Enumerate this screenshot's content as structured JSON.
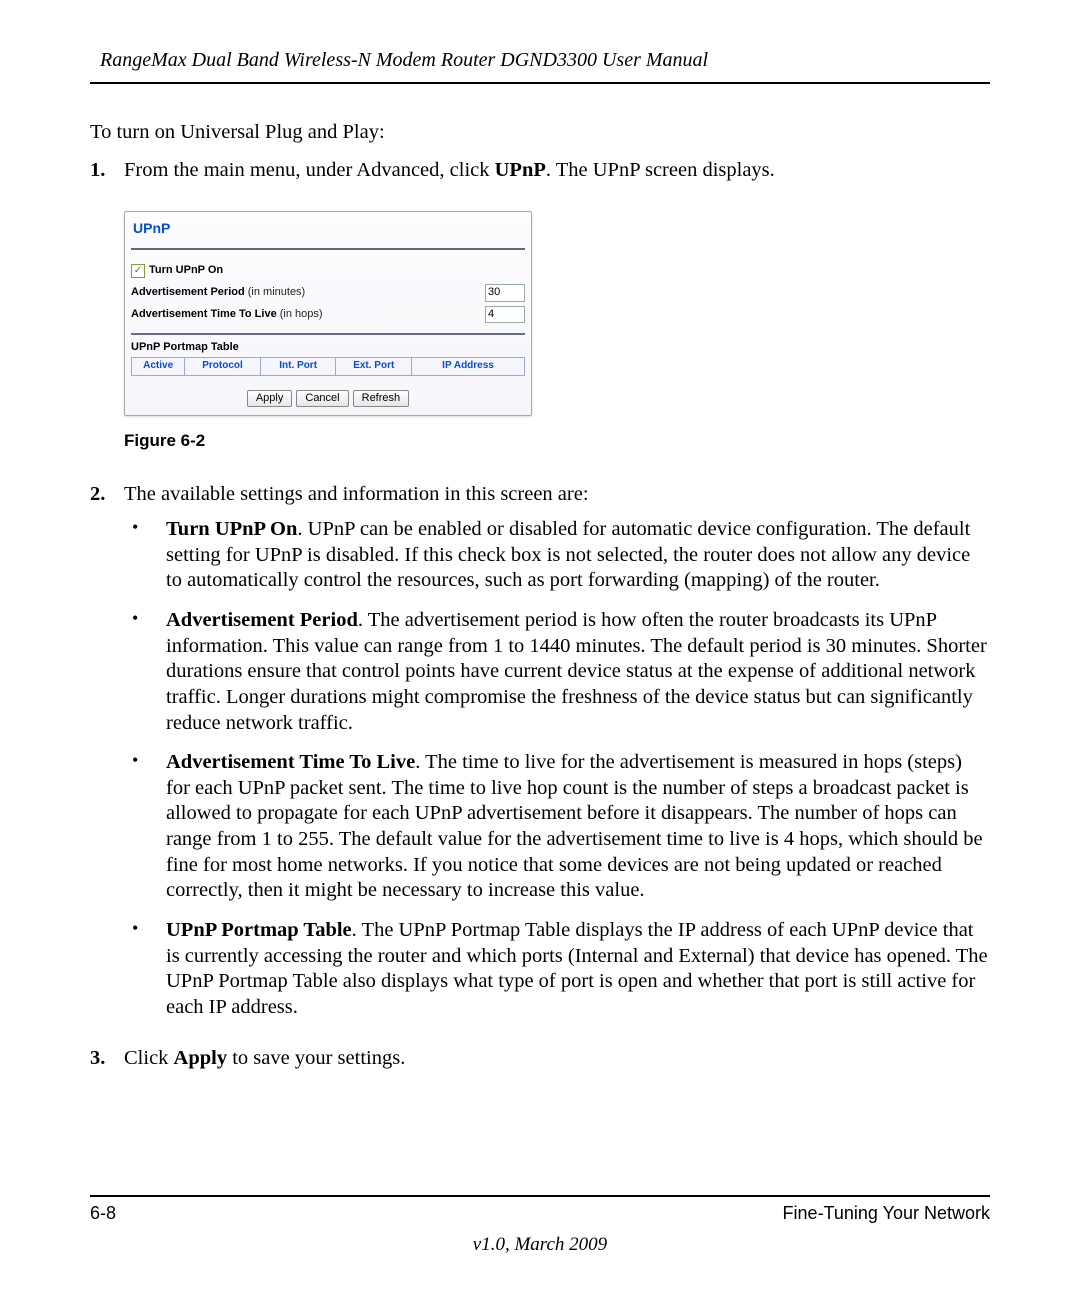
{
  "header": {
    "title": "RangeMax Dual Band Wireless-N Modem Router DGND3300 User Manual"
  },
  "intro": "To turn on Universal Plug and Play:",
  "steps": {
    "s1": {
      "num": "1.",
      "pre": "From the main menu, under Advanced, click ",
      "bold": "UPnP",
      "post": ". The UPnP screen displays."
    },
    "s2": {
      "num": "2.",
      "text": "The available settings and information in this screen are:"
    },
    "s3": {
      "num": "3.",
      "pre": "Click ",
      "bold": "Apply",
      "post": " to save your settings."
    }
  },
  "figure": {
    "caption": "Figure 6-2"
  },
  "upnp": {
    "title": "UPnP",
    "checkbox_label": "Turn UPnP On",
    "check_mark": "✓",
    "adv_period_label_b": "Advertisement Period",
    "adv_period_label_l": " (in minutes)",
    "adv_period_value": "30",
    "adv_ttl_label_b": "Advertisement Time To Live",
    "adv_ttl_label_l": " (in hops)",
    "adv_ttl_value": "4",
    "portmap_title": "UPnP Portmap Table",
    "cols": {
      "c0": "Active",
      "c1": "Protocol",
      "c2": "Int. Port",
      "c3": "Ext. Port",
      "c4": "IP Address"
    },
    "btn_apply": "Apply",
    "btn_cancel": "Cancel",
    "btn_refresh": "Refresh"
  },
  "bullets": {
    "b1": {
      "title": "Turn UPnP On",
      "text": ". UPnP can be enabled or disabled for automatic device configuration. The default setting for UPnP is disabled. If this check box is not selected, the router does not allow any device to automatically control the resources, such as port forwarding (mapping) of the router."
    },
    "b2": {
      "title": "Advertisement Period",
      "text": ". The advertisement period is how often the router broadcasts its UPnP information. This value can range from 1 to 1440 minutes. The default period is 30 minutes. Shorter durations ensure that control points have current device status at the expense of additional network traffic. Longer durations might compromise the freshness of the device status but can significantly reduce network traffic."
    },
    "b3": {
      "title": "Advertisement Time To Live",
      "text": ". The time to live for the advertisement is measured in hops (steps) for each UPnP packet sent. The time to live hop count is the number of steps a broadcast packet is allowed to propagate for each UPnP advertisement before it disappears. The number of hops can range from 1 to 255. The default value for the advertisement time to live is 4 hops, which should be fine for most home networks. If you notice that some devices are not being updated or reached correctly, then it might be necessary to increase this value."
    },
    "b4": {
      "title": "UPnP Portmap Table",
      "text": ". The UPnP Portmap Table displays the IP address of each UPnP device that is currently accessing the router and which ports (Internal and External) that device has opened. The UPnP Portmap Table also displays what type of port is open and whether that port is still active for each IP address."
    }
  },
  "footer": {
    "page": "6-8",
    "section": "Fine-Tuning Your Network",
    "version": "v1.0, March 2009"
  }
}
